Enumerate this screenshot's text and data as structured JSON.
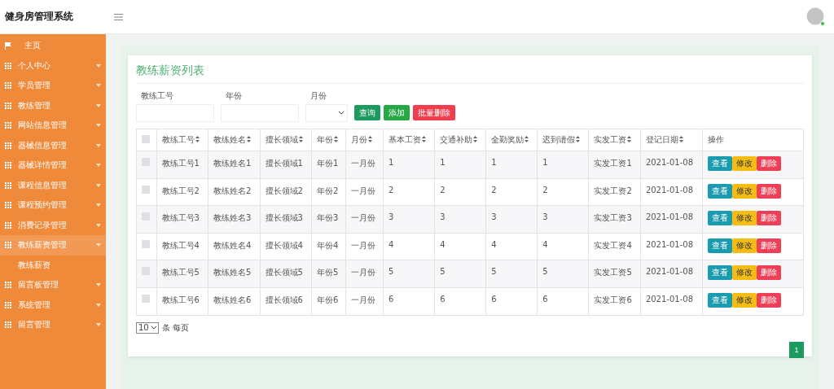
{
  "app_title": "健身房管理系统",
  "sidebar": {
    "items": [
      {
        "label": "主页",
        "kind": "home",
        "selected": false
      },
      {
        "label": "个人中心",
        "kind": "menu",
        "selected": false
      },
      {
        "label": "学员管理",
        "kind": "menu",
        "selected": false
      },
      {
        "label": "教练管理",
        "kind": "menu",
        "selected": false
      },
      {
        "label": "网站信息管理",
        "kind": "menu",
        "selected": false
      },
      {
        "label": "器械信息管理",
        "kind": "menu",
        "selected": false
      },
      {
        "label": "器械详情管理",
        "kind": "menu",
        "selected": false
      },
      {
        "label": "课程信息管理",
        "kind": "menu",
        "selected": false
      },
      {
        "label": "课程预约管理",
        "kind": "menu",
        "selected": false
      },
      {
        "label": "消费记录管理",
        "kind": "menu",
        "selected": false
      },
      {
        "label": "教练薪资管理",
        "kind": "menu",
        "selected": true,
        "children": [
          {
            "label": "教练薪资"
          }
        ]
      },
      {
        "label": "留言板管理",
        "kind": "menu",
        "selected": false
      },
      {
        "label": "系统管理",
        "kind": "menu",
        "selected": false
      },
      {
        "label": "留言管理",
        "kind": "menu",
        "selected": false
      }
    ]
  },
  "page_title": "教练薪资列表",
  "filters": [
    {
      "label": "教练工号",
      "kind": "text"
    },
    {
      "label": "年份",
      "kind": "text"
    },
    {
      "label": "月份",
      "kind": "select"
    }
  ],
  "actions": [
    {
      "label": "查询",
      "kind": "search"
    },
    {
      "label": "添加",
      "kind": "add"
    },
    {
      "label": "批量删除",
      "kind": "delete"
    }
  ],
  "table": {
    "all_checked": false,
    "columns": [
      {
        "label": "教练工号",
        "sortable": true
      },
      {
        "label": "教练姓名",
        "sortable": true
      },
      {
        "label": "擅长领域",
        "sortable": true
      },
      {
        "label": "年份",
        "sortable": true
      },
      {
        "label": "月份",
        "sortable": true
      },
      {
        "label": "基本工资",
        "sortable": true
      },
      {
        "label": "交通补助",
        "sortable": true
      },
      {
        "label": "全勤奖励",
        "sortable": true
      },
      {
        "label": "迟到请假",
        "sortable": true
      },
      {
        "label": "实发工资",
        "sortable": true
      },
      {
        "label": "登记日期",
        "sortable": true
      },
      {
        "label": "操作",
        "sortable": false
      }
    ],
    "rows": [
      {
        "checked": false,
        "cells": [
          "教练工号1",
          "教练姓名1",
          "擅长领域1",
          "年份1",
          "一月份",
          "1",
          "1",
          "1",
          "1",
          "实发工资1",
          "2021-01-08"
        ],
        "buttons": [
          "查看",
          "修改",
          "删除"
        ]
      },
      {
        "checked": false,
        "cells": [
          "教练工号2",
          "教练姓名2",
          "擅长领域2",
          "年份2",
          "一月份",
          "2",
          "2",
          "2",
          "2",
          "实发工资2",
          "2021-01-08"
        ],
        "buttons": [
          "查看",
          "修改",
          "删除"
        ]
      },
      {
        "checked": false,
        "cells": [
          "教练工号3",
          "教练姓名3",
          "擅长领域3",
          "年份3",
          "一月份",
          "3",
          "3",
          "3",
          "3",
          "实发工资3",
          "2021-01-08"
        ],
        "buttons": [
          "查看",
          "修改",
          "删除"
        ]
      },
      {
        "checked": false,
        "cells": [
          "教练工号4",
          "教练姓名4",
          "擅长领域4",
          "年份4",
          "一月份",
          "4",
          "4",
          "4",
          "4",
          "实发工资4",
          "2021-01-08"
        ],
        "buttons": [
          "查看",
          "修改",
          "删除"
        ]
      },
      {
        "checked": false,
        "cells": [
          "教练工号5",
          "教练姓名5",
          "擅长领域5",
          "年份5",
          "一月份",
          "5",
          "5",
          "5",
          "5",
          "实发工资5",
          "2021-01-08"
        ],
        "buttons": [
          "查看",
          "修改",
          "删除"
        ]
      },
      {
        "checked": false,
        "cells": [
          "教练工号6",
          "教练姓名6",
          "擅长领域6",
          "年份6",
          "一月份",
          "6",
          "6",
          "6",
          "6",
          "实发工资6",
          "2021-01-08"
        ],
        "buttons": [
          "查看",
          "修改",
          "删除"
        ]
      }
    ]
  },
  "page_size": {
    "value": "10",
    "suffix": "条 每页"
  },
  "pagination": [
    {
      "label": "1",
      "selected": true
    }
  ]
}
